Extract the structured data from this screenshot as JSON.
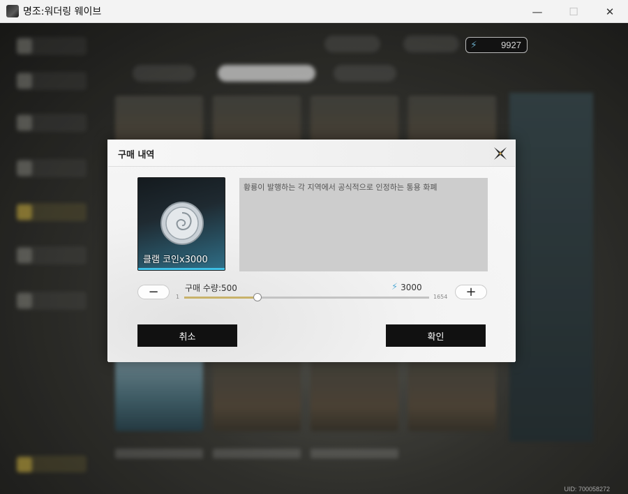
{
  "window": {
    "title": "명조:워더링 웨이브",
    "minimize": "—",
    "maximize": "☐",
    "close": "✕"
  },
  "header": {
    "currency_value": "9927",
    "currency_icon": "astrite-icon"
  },
  "modal": {
    "title": "구매 내역",
    "item_name": "클램 코인x3000",
    "description": "황룡이 발행하는 각 지역에서 공식적으로 인정하는 통용 화폐",
    "quantity_label": "구매 수량:500",
    "quantity_min": "1",
    "quantity_max": "1654",
    "quantity_fraction": 0.3,
    "price": "3000",
    "minus_label": "−",
    "plus_label": "+",
    "cancel_label": "취소",
    "confirm_label": "확인"
  },
  "footer": {
    "uid": "UID: 700058272"
  },
  "colors": {
    "slider_fill": "#c8b26a",
    "button_dark": "#111111",
    "accent_blue": "#3fc2e8"
  }
}
